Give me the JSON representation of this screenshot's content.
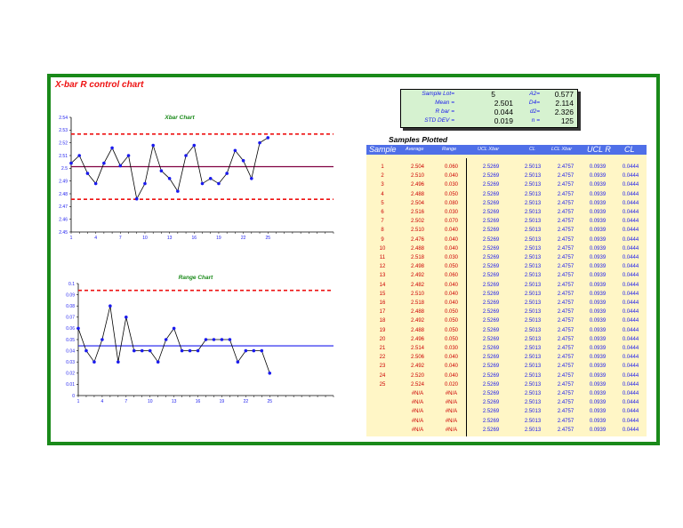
{
  "title": "X-bar R control chart",
  "stats": {
    "sample_lot_label": "Sample Lot=",
    "sample_lot": "5",
    "mean_label": "Mean =",
    "mean": "2.501",
    "rbar_label": "R bar =",
    "rbar": "0.044",
    "std_label": "STD DEV =",
    "std": "0.019",
    "a2_label": "A2=",
    "a2": "0.577",
    "d4_label": "D4=",
    "d4": "2.114",
    "d2_label": "d2=",
    "d2": "2.326",
    "n_label": "n =",
    "n": "125"
  },
  "table": {
    "title": "Samples Plotted",
    "headers": [
      "Sample",
      "Average",
      "Range",
      "UCL Xbar",
      "CL",
      "LCL Xbar",
      "UCL R",
      "CL"
    ],
    "constants": {
      "ucl_xbar": "2.5269",
      "cl_xbar": "2.5013",
      "lcl_xbar": "2.4757",
      "ucl_r": "0.0939",
      "cl_r": "0.0444"
    },
    "na": "#N/A",
    "rows": [
      [
        "1",
        "2.504",
        "0.060"
      ],
      [
        "2",
        "2.510",
        "0.040"
      ],
      [
        "3",
        "2.496",
        "0.030"
      ],
      [
        "4",
        "2.488",
        "0.050"
      ],
      [
        "5",
        "2.504",
        "0.080"
      ],
      [
        "6",
        "2.516",
        "0.030"
      ],
      [
        "7",
        "2.502",
        "0.070"
      ],
      [
        "8",
        "2.510",
        "0.040"
      ],
      [
        "9",
        "2.476",
        "0.040"
      ],
      [
        "10",
        "2.488",
        "0.040"
      ],
      [
        "11",
        "2.518",
        "0.030"
      ],
      [
        "12",
        "2.498",
        "0.050"
      ],
      [
        "13",
        "2.492",
        "0.060"
      ],
      [
        "14",
        "2.482",
        "0.040"
      ],
      [
        "15",
        "2.510",
        "0.040"
      ],
      [
        "16",
        "2.518",
        "0.040"
      ],
      [
        "17",
        "2.488",
        "0.050"
      ],
      [
        "18",
        "2.492",
        "0.050"
      ],
      [
        "19",
        "2.488",
        "0.050"
      ],
      [
        "20",
        "2.496",
        "0.050"
      ],
      [
        "21",
        "2.514",
        "0.030"
      ],
      [
        "22",
        "2.506",
        "0.040"
      ],
      [
        "23",
        "2.492",
        "0.040"
      ],
      [
        "24",
        "2.520",
        "0.040"
      ],
      [
        "25",
        "2.524",
        "0.020"
      ],
      [
        "",
        "#N/A",
        "#N/A"
      ],
      [
        "",
        "#N/A",
        "#N/A"
      ],
      [
        "",
        "#N/A",
        "#N/A"
      ],
      [
        "",
        "#N/A",
        "#N/A"
      ],
      [
        "",
        "#N/A",
        "#N/A"
      ]
    ]
  },
  "colors": {
    "frame": "#1a8a1a",
    "limit": "#ee1111",
    "center_x": "#800040",
    "center_r": "#1a1aee",
    "series": "#000000",
    "marker": "#1a1aee"
  },
  "chart_data": [
    {
      "type": "line",
      "title": "Xbar Chart",
      "x": [
        1,
        2,
        3,
        4,
        5,
        6,
        7,
        8,
        9,
        10,
        11,
        12,
        13,
        14,
        15,
        16,
        17,
        18,
        19,
        20,
        21,
        22,
        23,
        24,
        25
      ],
      "values": [
        2.504,
        2.51,
        2.496,
        2.488,
        2.504,
        2.516,
        2.502,
        2.51,
        2.476,
        2.488,
        2.518,
        2.498,
        2.492,
        2.482,
        2.51,
        2.518,
        2.488,
        2.492,
        2.488,
        2.496,
        2.514,
        2.506,
        2.492,
        2.52,
        2.524
      ],
      "ucl": 2.5269,
      "cl": 2.5013,
      "lcl": 2.4757,
      "ylim": [
        2.45,
        2.54
      ],
      "yticks": [
        "2.54",
        "2.53",
        "2.52",
        "2.51",
        "2.5",
        "2.49",
        "2.48",
        "2.47",
        "2.46",
        "2.45"
      ],
      "xticks": [
        "1",
        "4",
        "7",
        "10",
        "13",
        "16",
        "19",
        "22",
        "25"
      ]
    },
    {
      "type": "line",
      "title": "Range Chart",
      "x": [
        1,
        2,
        3,
        4,
        5,
        6,
        7,
        8,
        9,
        10,
        11,
        12,
        13,
        14,
        15,
        16,
        17,
        18,
        19,
        20,
        21,
        22,
        23,
        24,
        25
      ],
      "values": [
        0.06,
        0.04,
        0.03,
        0.05,
        0.08,
        0.03,
        0.07,
        0.04,
        0.04,
        0.04,
        0.03,
        0.05,
        0.06,
        0.04,
        0.04,
        0.04,
        0.05,
        0.05,
        0.05,
        0.05,
        0.03,
        0.04,
        0.04,
        0.04,
        0.02
      ],
      "ucl": 0.0939,
      "cl": 0.0444,
      "ylim": [
        0,
        0.1
      ],
      "yticks": [
        "0.1",
        "0.09",
        "0.08",
        "0.07",
        "0.06",
        "0.05",
        "0.04",
        "0.03",
        "0.02",
        "0.01",
        "0"
      ],
      "xticks": [
        "1",
        "4",
        "7",
        "10",
        "13",
        "16",
        "19",
        "22",
        "25"
      ]
    }
  ]
}
